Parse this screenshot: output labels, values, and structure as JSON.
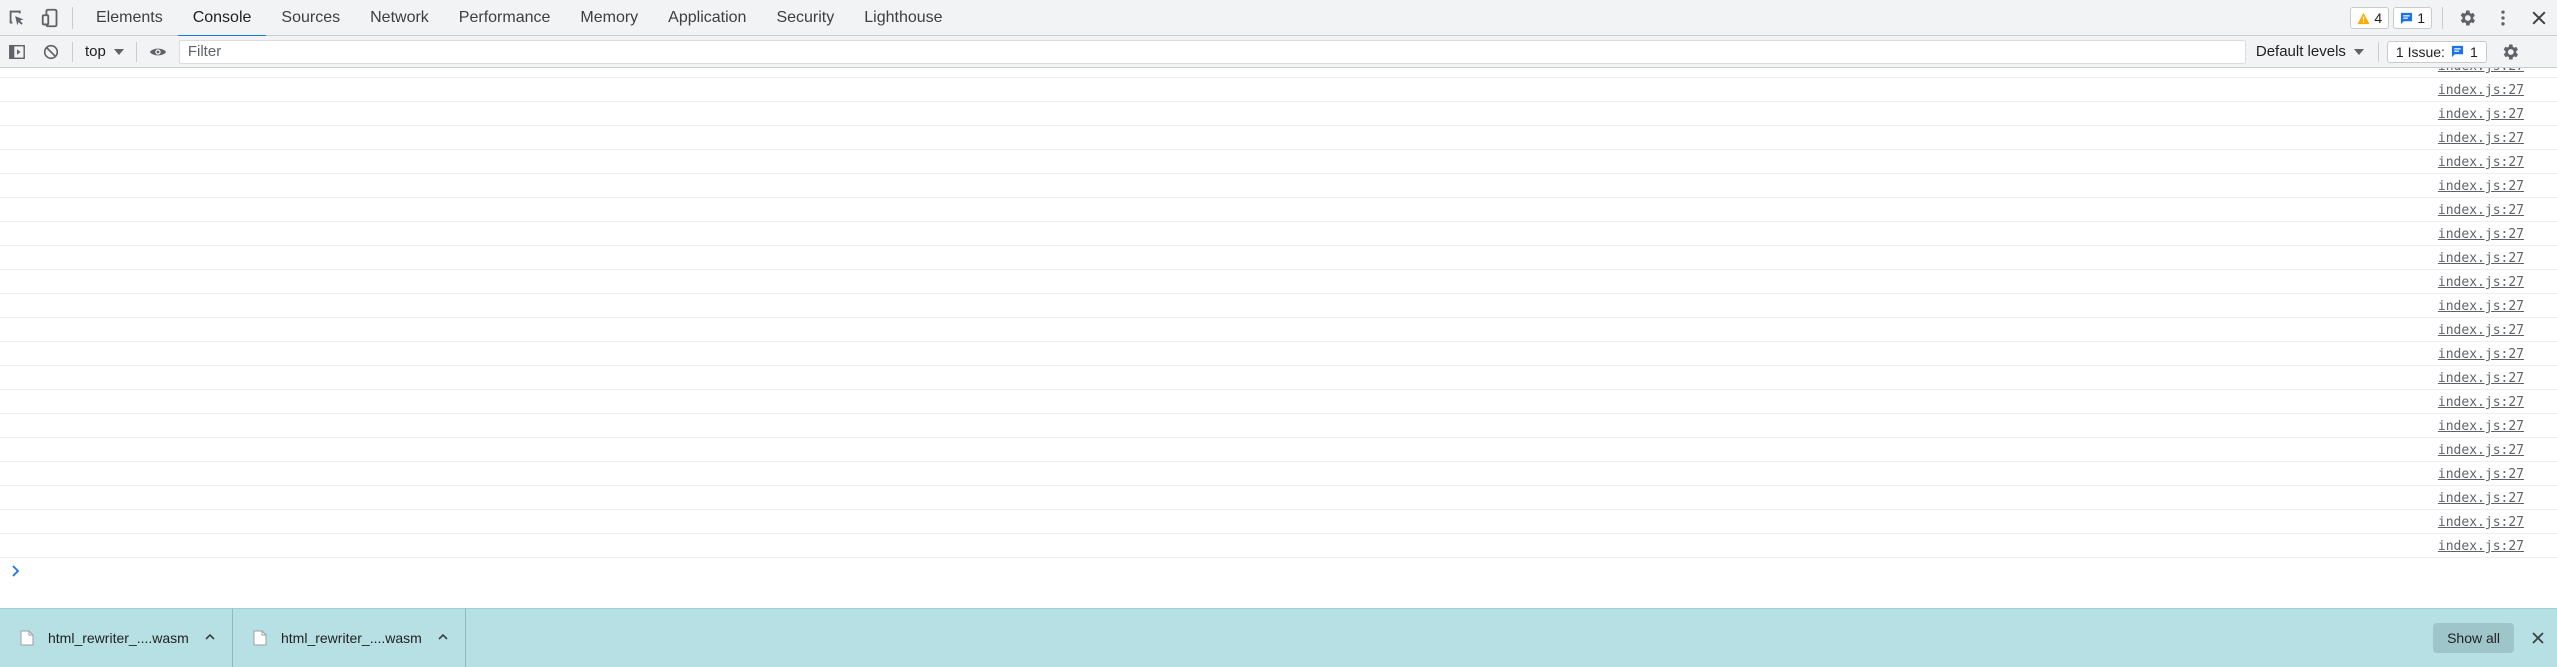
{
  "tabbar": {
    "tabs": [
      "Elements",
      "Console",
      "Sources",
      "Network",
      "Performance",
      "Memory",
      "Application",
      "Security",
      "Lighthouse"
    ],
    "active_tab": "Console",
    "warnings_count": "4",
    "messages_count": "1"
  },
  "toolbar": {
    "context": "top",
    "filter_placeholder": "Filter",
    "levels": "Default levels",
    "issues_label": "1 Issue:",
    "issues_count": "1"
  },
  "console": {
    "source_link": "index.js:27",
    "row_count": 21
  },
  "downloads": {
    "items": [
      "html_rewriter_....wasm",
      "html_rewriter_....wasm"
    ],
    "show_all": "Show all"
  },
  "colors": {
    "accent": "#1a73e8",
    "warning": "#f9ab00",
    "shelf": "#b7e0e5"
  }
}
